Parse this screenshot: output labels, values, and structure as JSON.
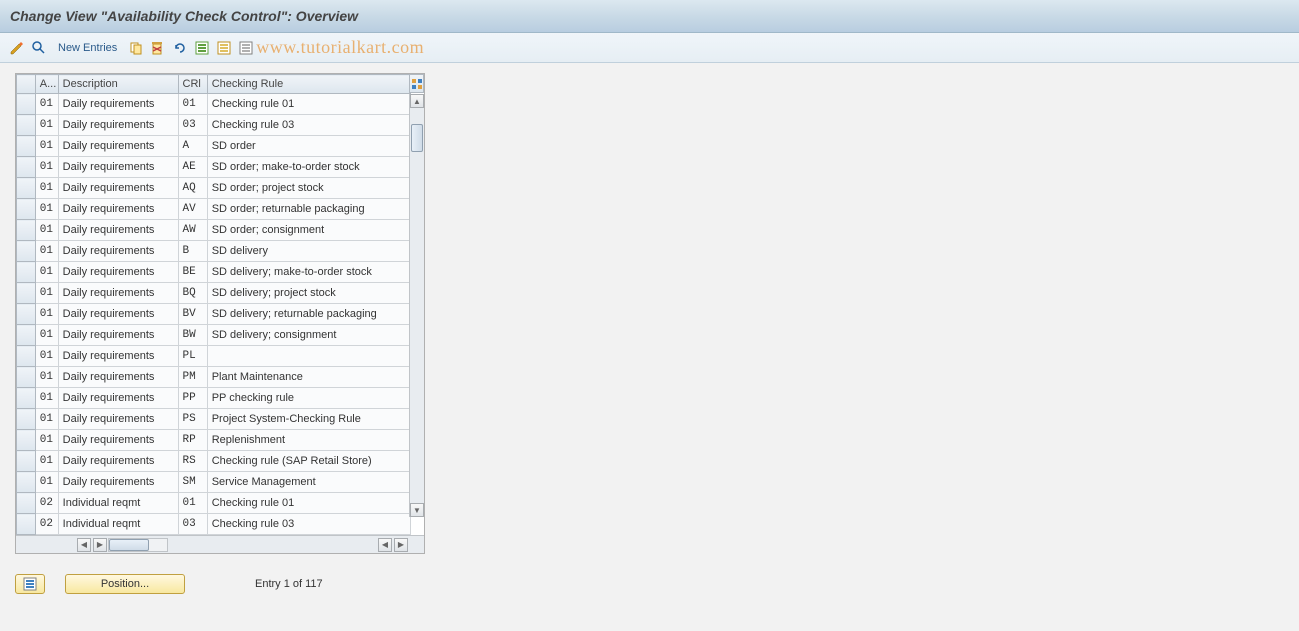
{
  "title": "Change View \"Availability Check Control\": Overview",
  "toolbar": {
    "new_entries": "New Entries"
  },
  "watermark": "www.tutorialkart.com",
  "table": {
    "headers": {
      "a": "A...",
      "desc": "Description",
      "crl": "CRl",
      "rule": "Checking Rule"
    },
    "rows": [
      {
        "a": "01",
        "desc": "Daily requirements",
        "crl": "01",
        "rule": "Checking rule 01"
      },
      {
        "a": "01",
        "desc": "Daily requirements",
        "crl": "03",
        "rule": "Checking rule 03"
      },
      {
        "a": "01",
        "desc": "Daily requirements",
        "crl": "A",
        "rule": "SD order"
      },
      {
        "a": "01",
        "desc": "Daily requirements",
        "crl": "AE",
        "rule": "SD order; make-to-order stock"
      },
      {
        "a": "01",
        "desc": "Daily requirements",
        "crl": "AQ",
        "rule": "SD order; project stock"
      },
      {
        "a": "01",
        "desc": "Daily requirements",
        "crl": "AV",
        "rule": "SD order; returnable packaging"
      },
      {
        "a": "01",
        "desc": "Daily requirements",
        "crl": "AW",
        "rule": "SD order; consignment"
      },
      {
        "a": "01",
        "desc": "Daily requirements",
        "crl": "B",
        "rule": "SD delivery"
      },
      {
        "a": "01",
        "desc": "Daily requirements",
        "crl": "BE",
        "rule": "SD delivery; make-to-order stock"
      },
      {
        "a": "01",
        "desc": "Daily requirements",
        "crl": "BQ",
        "rule": "SD delivery; project stock"
      },
      {
        "a": "01",
        "desc": "Daily requirements",
        "crl": "BV",
        "rule": "SD delivery; returnable packaging"
      },
      {
        "a": "01",
        "desc": "Daily requirements",
        "crl": "BW",
        "rule": "SD delivery; consignment"
      },
      {
        "a": "01",
        "desc": "Daily requirements",
        "crl": "PL",
        "rule": ""
      },
      {
        "a": "01",
        "desc": "Daily requirements",
        "crl": "PM",
        "rule": "Plant Maintenance"
      },
      {
        "a": "01",
        "desc": "Daily requirements",
        "crl": "PP",
        "rule": "PP checking rule"
      },
      {
        "a": "01",
        "desc": "Daily requirements",
        "crl": "PS",
        "rule": "Project System-Checking Rule"
      },
      {
        "a": "01",
        "desc": "Daily requirements",
        "crl": "RP",
        "rule": "Replenishment"
      },
      {
        "a": "01",
        "desc": "Daily requirements",
        "crl": "RS",
        "rule": "Checking rule (SAP Retail Store)"
      },
      {
        "a": "01",
        "desc": "Daily requirements",
        "crl": "SM",
        "rule": "Service Management"
      },
      {
        "a": "02",
        "desc": "Individual reqmt",
        "crl": "01",
        "rule": "Checking rule 01"
      },
      {
        "a": "02",
        "desc": "Individual reqmt",
        "crl": "03",
        "rule": "Checking rule 03"
      }
    ]
  },
  "footer": {
    "position_label": "Position...",
    "entry_status": "Entry 1 of 117"
  }
}
